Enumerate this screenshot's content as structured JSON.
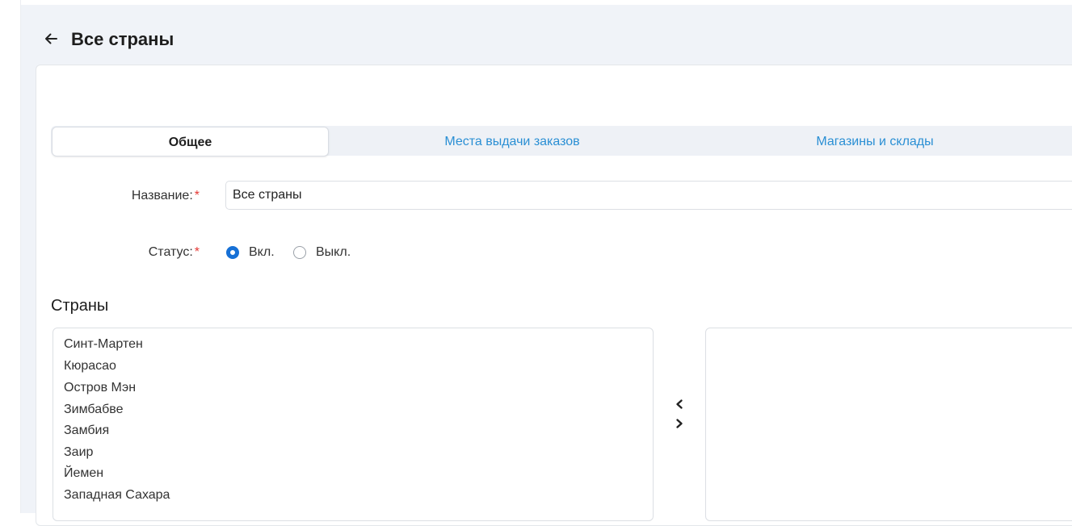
{
  "header": {
    "title": "Все страны"
  },
  "tabs": [
    {
      "label": "Общее",
      "active": true
    },
    {
      "label": "Места выдачи заказов",
      "active": false
    },
    {
      "label": "Магазины и склады",
      "active": false
    }
  ],
  "form": {
    "name_label": "Название:",
    "name_value": "Все страны",
    "status_label": "Статус:",
    "required_mark": "*",
    "status_on_label": "Вкл.",
    "status_off_label": "Выкл.",
    "status_selected": "Вкл."
  },
  "countries": {
    "title": "Страны",
    "available": [
      "Синт-Мартен",
      "Кюрасао",
      "Остров Мэн",
      "Зимбабве",
      "Замбия",
      "Заир",
      "Йемен",
      "Западная Сахара"
    ],
    "selected": []
  },
  "colors": {
    "accent": "#1670d6",
    "link": "#2a8fd4",
    "required": "#e53935",
    "page_bg": "#f0f3f8"
  },
  "icons": {
    "back": "arrow-left-icon",
    "move_left": "chevron-left-icon",
    "move_right": "chevron-right-icon"
  }
}
